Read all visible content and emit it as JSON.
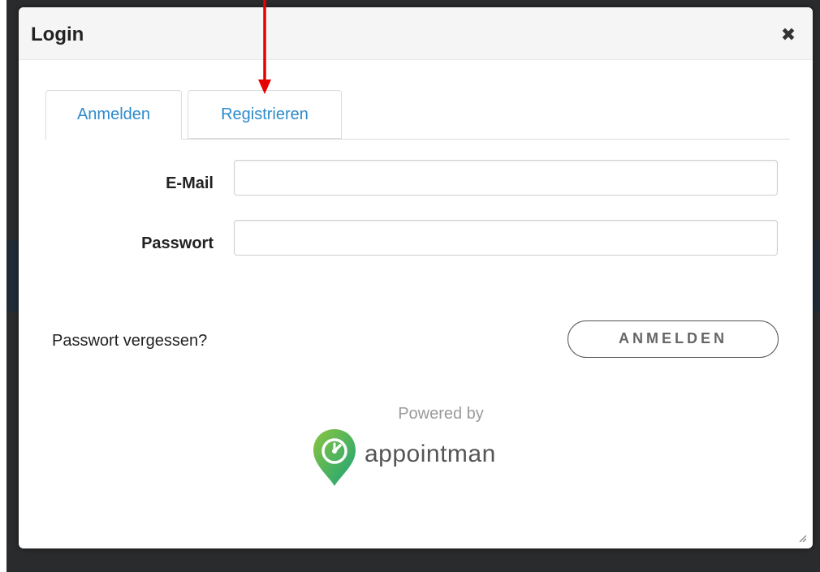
{
  "modal": {
    "title": "Login",
    "close_symbol": "✖"
  },
  "tabs": [
    {
      "label": "Anmelden",
      "active": true
    },
    {
      "label": "Registrieren",
      "active": false
    }
  ],
  "form": {
    "email_label": "E-Mail",
    "email_value": "",
    "email_placeholder": "",
    "password_label": "Passwort",
    "password_value": "",
    "password_placeholder": ""
  },
  "actions": {
    "forgot_password": "Passwort vergessen?",
    "login_button": "ANMELDEN"
  },
  "footer": {
    "powered_by": "Powered by",
    "brand_name": "appointman"
  },
  "colors": {
    "tab_text": "#2d8bcb",
    "annotation": "#e60000",
    "brand_green": "#2fa84f",
    "backdrop": "#2a2b2d"
  },
  "icons": {
    "close": "close-icon",
    "brand": "appointman-logo-icon",
    "annotation": "red-arrow-icon",
    "resize": "resize-grip-icon"
  }
}
